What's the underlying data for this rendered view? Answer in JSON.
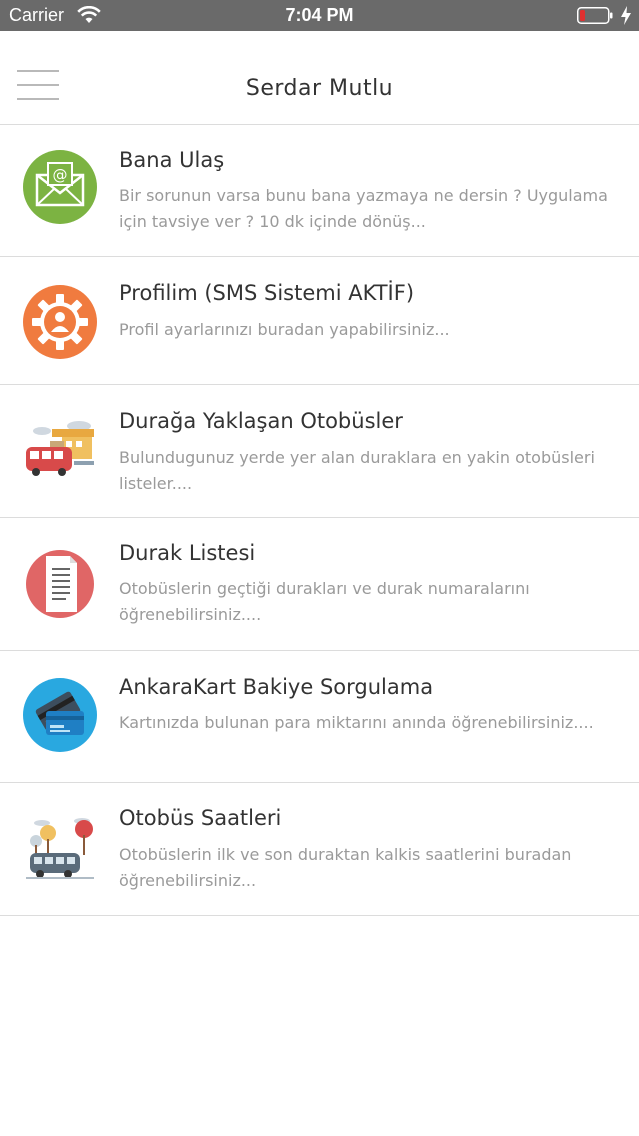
{
  "status_bar": {
    "carrier": "Carrier",
    "time": "7:04 PM",
    "icons": [
      "wifi-icon",
      "battery-icon",
      "charging-icon"
    ]
  },
  "nav": {
    "title": "Serdar Mutlu",
    "menu_icon": "hamburger-menu-icon"
  },
  "items": [
    {
      "title": "Bana Ulaş",
      "desc": "Bir sorunun varsa bunu bana yazmaya ne dersin ? Uygulama için tavsiye ver ? 10 dk içinde dönüş...",
      "icon": "envelope-icon",
      "color": "#7cb342"
    },
    {
      "title": "Profilim (SMS Sistemi AKTİF)",
      "desc": "Profil ayarlarınızı buradan yapabilirsiniz...",
      "icon": "profile-gear-icon",
      "color": "#f07b3f"
    },
    {
      "title": "Durağa Yaklaşan Otobüsler",
      "desc": "Bulundugunuz yerde yer alan duraklara en yakin otobüsleri listeler....",
      "icon": "bus-city-icon",
      "color": "#d84a4a"
    },
    {
      "title": "Durak Listesi",
      "desc": "Otobüslerin geçtiği durakları ve durak numaralarını öğrenebilirsiniz....",
      "icon": "document-list-icon",
      "color": "#e06666"
    },
    {
      "title": "AnkaraKart Bakiye Sorgulama",
      "desc": "Kartınızda bulunan para miktarını anında öğrenebilirsiniz....",
      "icon": "credit-card-icon",
      "color": "#29a8e0"
    },
    {
      "title": "Otobüs Saatleri",
      "desc": "Otobüslerin ilk ve son duraktan kalkis saatlerini buradan öğrenebilirsiniz...",
      "icon": "bus-trees-icon",
      "color": "#5a6b7a"
    }
  ]
}
